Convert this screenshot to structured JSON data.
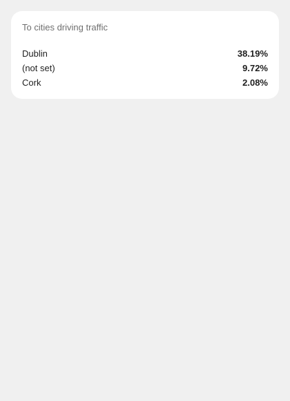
{
  "card": {
    "title": "To cities driving traffic",
    "rows": [
      {
        "label": "Dublin",
        "value": "38.19%"
      },
      {
        "label": "(not set)",
        "value": "9.72%"
      },
      {
        "label": "Cork",
        "value": "2.08%"
      }
    ]
  }
}
